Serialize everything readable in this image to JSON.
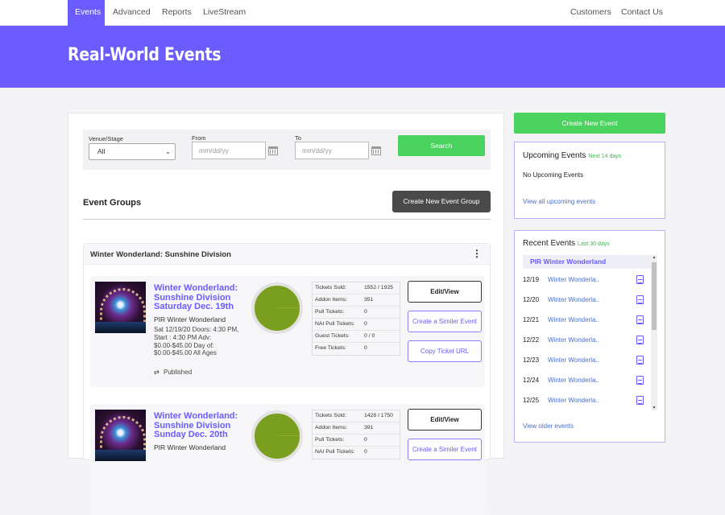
{
  "nav": {
    "left": [
      "Events",
      "Advanced",
      "Reports",
      "LiveStream"
    ],
    "right": [
      "Customers",
      "Contact Us"
    ],
    "active": "Events"
  },
  "hero": {
    "title": "Real-World Events"
  },
  "filters": {
    "venue_label": "Venue/Stage",
    "venue_value": "All",
    "from_label": "From",
    "from_placeholder": "mm/dd/yy",
    "to_label": "To",
    "to_placeholder": "mm/dd/yy",
    "search_label": "Search"
  },
  "event_groups": {
    "title": "Event Groups",
    "create_group_label": "Create New Event Group"
  },
  "group": {
    "title": "Winter Wonderland: Sunshine Division",
    "menu_icon": "kebab-icon",
    "events": [
      {
        "title": "Winter Wonderland: Sunshine Division Saturday Dec. 19th",
        "venue": "PIR Winter Wonderland",
        "details": "Sat 12/19/20 Doors: 4:30 PM, Start : 4:30 PM Adv: $0.00-$45.00 Day of: $0.00-$45.00 All Ages",
        "status": "Published",
        "sold_fraction": 0.806,
        "stats": [
          {
            "label": "Tickets Sold:",
            "value": "1552 / 1925"
          },
          {
            "label": "Addon Items:",
            "value": "351"
          },
          {
            "label": "Pull Tickets:",
            "value": "0"
          },
          {
            "label": "NAI Pull Tickets:",
            "value": "0"
          },
          {
            "label": "Guest Tickets:",
            "value": "0 / 0"
          },
          {
            "label": "Free Tickets:",
            "value": "0"
          }
        ],
        "actions": [
          "Edit/View",
          "Create a Similer Event",
          "Copy Ticket URL"
        ]
      },
      {
        "title": "Winter Wonderland: Sunshine Division Sunday Dec. 20th",
        "venue": "PIR Winter Wonderland",
        "sold_fraction": 0.816,
        "stats": [
          {
            "label": "Tickets Sold:",
            "value": "1428 / 1750"
          },
          {
            "label": "Addon Items:",
            "value": "391"
          },
          {
            "label": "Pull Tickets:",
            "value": "0"
          },
          {
            "label": "NAI Pull Tickets:",
            "value": "0"
          }
        ],
        "actions": [
          "Edit/View",
          "Create a Similer Event"
        ]
      }
    ]
  },
  "sidebar": {
    "create_event_label": "Create New Event",
    "upcoming": {
      "title": "Upcoming Events",
      "subtitle": "Next 14 days",
      "empty_text": "No Upcoming Events",
      "link": "View all upcoming events"
    },
    "recent": {
      "title": "Recent Events",
      "subtitle": "Last 30 days",
      "group": "PIR Winter Wonderland",
      "rows": [
        {
          "date": "12/19",
          "name": "Winter Wonderla.."
        },
        {
          "date": "12/20",
          "name": "Winter Wonderla.."
        },
        {
          "date": "12/21",
          "name": "Winter Wonderla.."
        },
        {
          "date": "12/22",
          "name": "Winter Wonderla.."
        },
        {
          "date": "12/23",
          "name": "Winter Wonderla.."
        },
        {
          "date": "12/24",
          "name": "Winter Wonderla.."
        },
        {
          "date": "12/25",
          "name": "Winter Wonderla.."
        }
      ],
      "link": "View older events"
    }
  },
  "colors": {
    "brand": "#6a5cff",
    "success": "#4ad35f",
    "pie_fill": "#7a9e1e"
  }
}
